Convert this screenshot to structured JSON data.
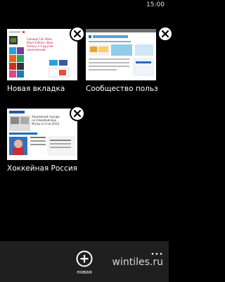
{
  "status": {
    "time": "15:00"
  },
  "tabs": [
    {
      "title": "Новая вкладка",
      "thumbnail_heading": "Свежие Full Wide, Black Edition, New Galaxy и 3 других приложений"
    },
    {
      "title": "Сообщество польз"
    },
    {
      "title": "Хоккейная Россия",
      "thumbnail_heading": "Хоккейный турнир на Олимпийских Играх в Сочи 2014"
    }
  ],
  "toolbar": {
    "new_tab_label": "новая",
    "watermark": "wintiles.ru"
  }
}
